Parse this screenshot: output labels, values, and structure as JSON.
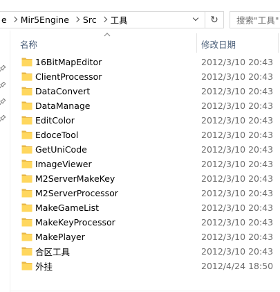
{
  "address_bar": {
    "crumbs": [
      "e",
      "Mir5Engine",
      "Src",
      "工具"
    ]
  },
  "search": {
    "placeholder": "搜索\"工具\""
  },
  "columns": {
    "name": "名称",
    "date_modified": "修改日期"
  },
  "files": [
    {
      "name": "16BitMapEditor",
      "date": "2012/3/10 20:43"
    },
    {
      "name": "ClientProcessor",
      "date": "2012/3/10 20:43"
    },
    {
      "name": "DataConvert",
      "date": "2012/3/10 20:43"
    },
    {
      "name": "DataManage",
      "date": "2012/3/10 20:43"
    },
    {
      "name": "EditColor",
      "date": "2012/3/10 20:43"
    },
    {
      "name": "EdoceTool",
      "date": "2012/3/10 20:43"
    },
    {
      "name": "GetUniCode",
      "date": "2012/3/10 20:43"
    },
    {
      "name": "ImageViewer",
      "date": "2012/3/10 20:43"
    },
    {
      "name": "M2ServerMakeKey",
      "date": "2012/3/10 20:43"
    },
    {
      "name": "M2ServerProcessor",
      "date": "2012/3/10 20:43"
    },
    {
      "name": "MakeGameList",
      "date": "2012/3/10 20:43"
    },
    {
      "name": "MakeKeyProcessor",
      "date": "2012/3/10 20:43"
    },
    {
      "name": "MakePlayer",
      "date": "2012/3/10 20:43"
    },
    {
      "name": "合区工具",
      "date": "2012/3/10 20:43"
    },
    {
      "name": "外挂",
      "date": "2012/4/24 18:50"
    }
  ],
  "colors": {
    "folder_body": "#ffd75e",
    "folder_tab": "#e8b84a",
    "header_text": "#4c607a",
    "date_text": "#6d6d6d"
  },
  "icons": {
    "folder": "folder-icon",
    "refresh": "refresh-icon",
    "sort": "sort-ascending-icon",
    "pin": "pin-icon",
    "chevron": "chevron-right-icon",
    "dropdown": "chevron-down-icon"
  }
}
